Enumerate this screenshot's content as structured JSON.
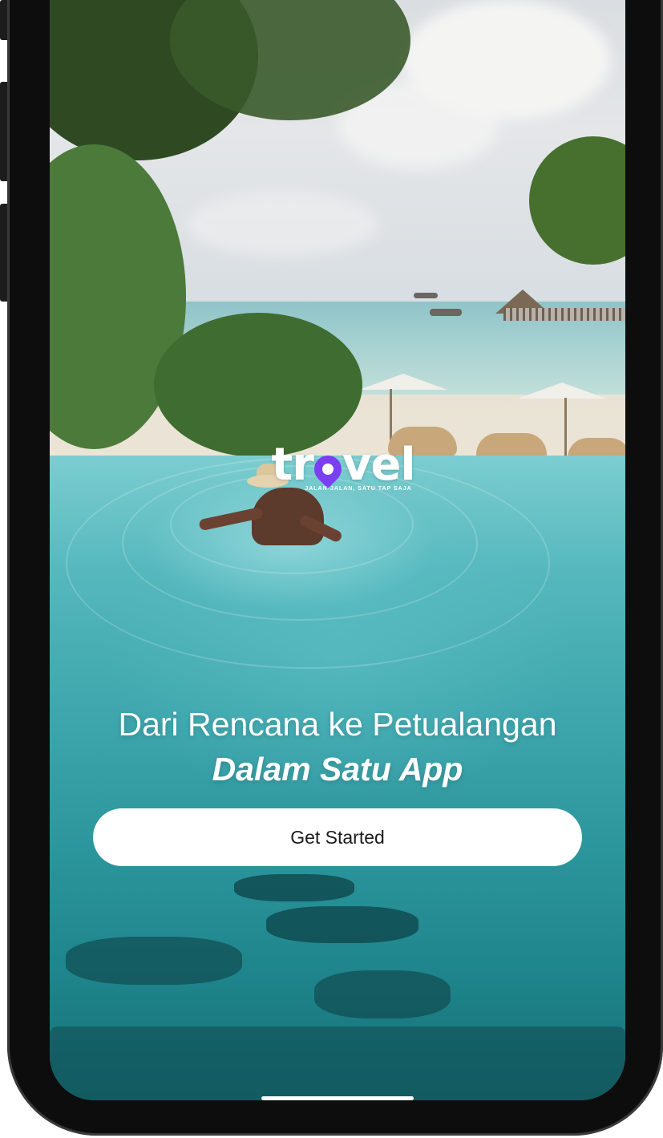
{
  "app": {
    "logo_text": "travel",
    "logo_tagline": "JALAN-JALAN, SATU TAP SAJA",
    "brand_accent": "#7b3ff2"
  },
  "hero": {
    "headline_line1": "Dari Rencana ke Petualangan",
    "headline_line2": "Dalam Satu App"
  },
  "actions": {
    "primary_label": "Get Started"
  },
  "colors": {
    "button_bg": "#ffffff",
    "button_text": "#1a1a1a",
    "pool_water": "#3ea6ad"
  }
}
